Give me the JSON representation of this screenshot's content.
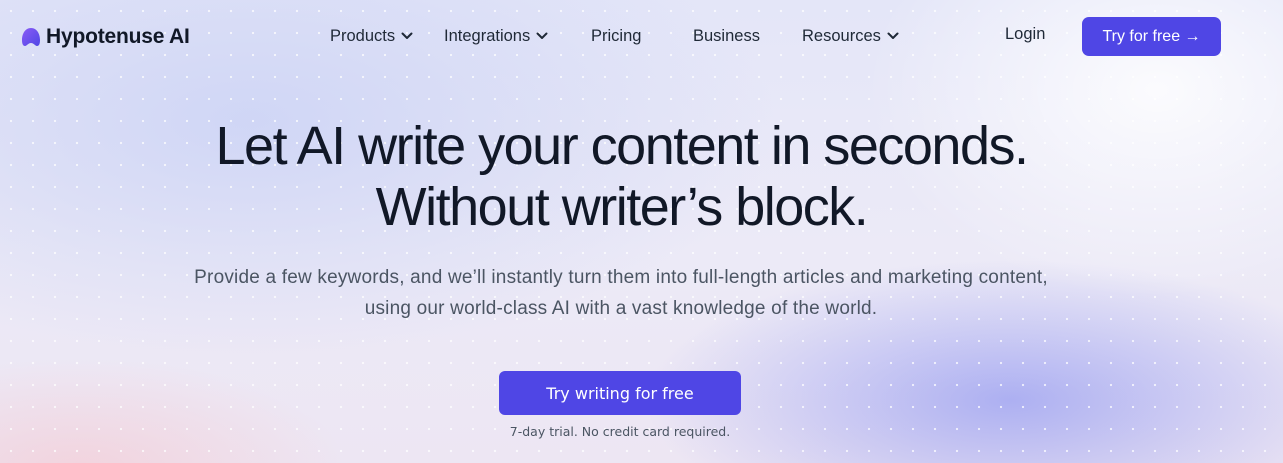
{
  "brand": {
    "name": "Hypotenuse AI",
    "icon": "logo-mark-icon",
    "accent": "#4f46e5"
  },
  "nav": {
    "items": [
      {
        "label": "Products",
        "dropdown": true
      },
      {
        "label": "Integrations",
        "dropdown": true
      },
      {
        "label": "Pricing",
        "dropdown": false
      },
      {
        "label": "Business",
        "dropdown": false
      },
      {
        "label": "Resources",
        "dropdown": true
      }
    ],
    "login": "Login",
    "cta": "Try for free →"
  },
  "hero": {
    "headline_line1": "Let AI write your content in seconds.",
    "headline_line2": "Without writer’s block.",
    "subtitle": "Provide a few keywords, and we’ll instantly turn them into full-length articles and marketing content, using our world-class AI with a vast knowledge of the world.",
    "cta": "Try writing for free",
    "note": "7-day trial. No credit card required."
  }
}
